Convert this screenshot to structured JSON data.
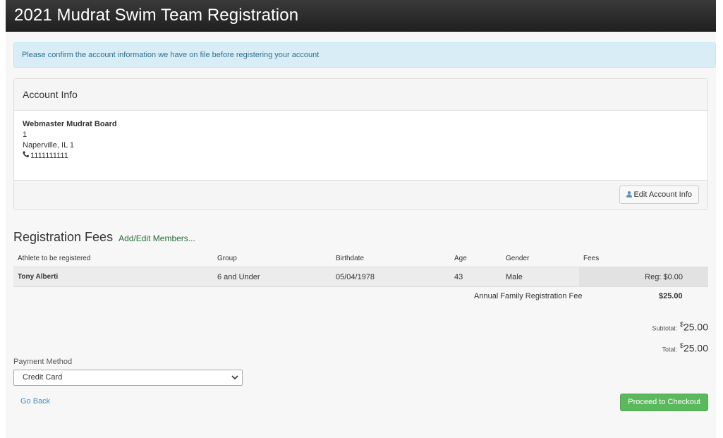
{
  "header": {
    "title": "2021 Mudrat Swim Team Registration"
  },
  "alert": {
    "text": "Please confirm the account information we have on file before registering your account"
  },
  "account": {
    "heading": "Account Info",
    "name": "Webmaster Mudrat Board",
    "address1": "1",
    "city_line": "Naperville, IL 1",
    "phone": "1111111111",
    "edit_label": "Edit Account Info"
  },
  "registration": {
    "title": "Registration Fees",
    "add_edit_link": "Add/Edit Members...",
    "columns": [
      "Athlete to be registered",
      "Group",
      "Birthdate",
      "Age",
      "Gender",
      "Fees"
    ],
    "rows": [
      {
        "athlete": "Tony Alberti",
        "group": "6 and Under",
        "birthdate": "05/04/1978",
        "age": "43",
        "gender": "Male",
        "fee_label": "Reg:",
        "fee_value": "$0.00"
      }
    ],
    "family_fee_label": "Annual Family Registration Fee",
    "family_fee_amount": "$25.00",
    "subtotal_label": "Subtotal:",
    "subtotal_currency": "$",
    "subtotal_value": "25.00",
    "total_label": "Total:",
    "total_currency": "$",
    "total_value": "25.00"
  },
  "payment": {
    "label": "Payment Method",
    "selected": "Credit Card"
  },
  "actions": {
    "go_back": "Go Back",
    "checkout": "Proceed to Checkout"
  },
  "colors": {
    "header_bg": "#262626",
    "alert_bg": "#d9edf7",
    "checkout_bg": "#5cb85c",
    "link": "#4a8ac6"
  }
}
